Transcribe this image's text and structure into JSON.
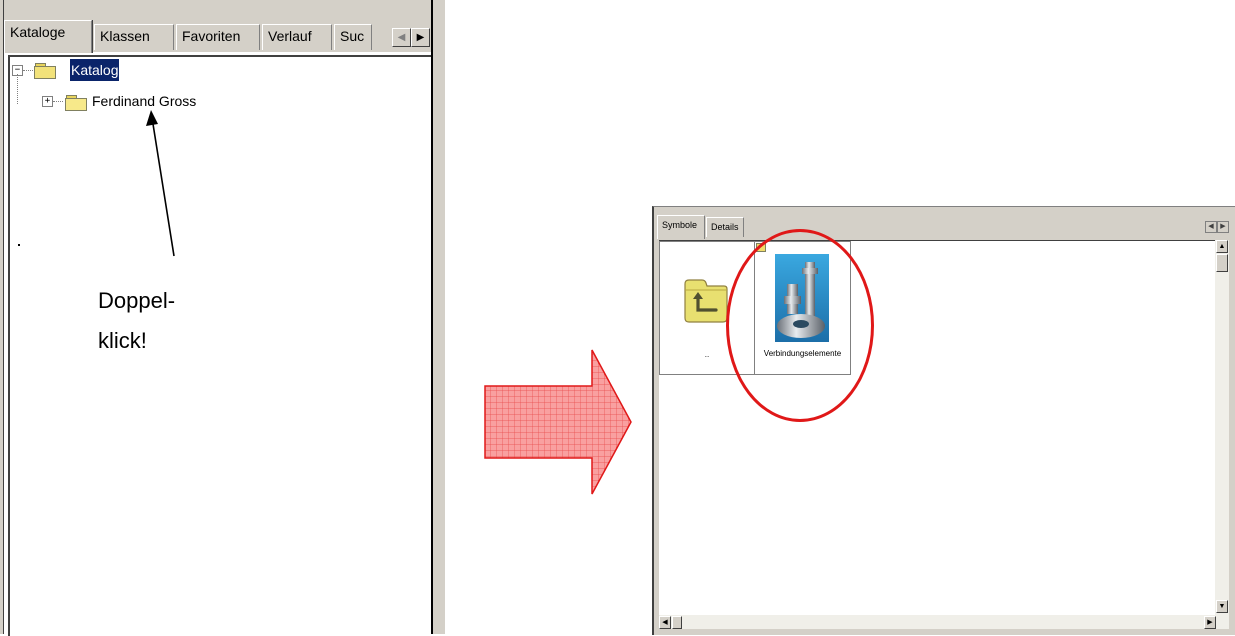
{
  "left_panel": {
    "tabs": [
      {
        "label": "Kataloge",
        "active": true
      },
      {
        "label": "Klassen",
        "active": false
      },
      {
        "label": "Favoriten",
        "active": false
      },
      {
        "label": "Verlauf",
        "active": false
      },
      {
        "label": "Suc",
        "active": false
      }
    ],
    "tree": {
      "root_label": "Katalog",
      "root_expanded": true,
      "root_selected": true,
      "children": [
        {
          "label": "Ferdinand Gross",
          "expanded": false
        }
      ]
    },
    "annotation": [
      "Doppel-",
      "klick!"
    ]
  },
  "right_window": {
    "tabs": [
      {
        "label": "Symbole",
        "active": true
      },
      {
        "label": "Details",
        "active": false
      }
    ],
    "items": [
      {
        "label": "..",
        "icon": "folder-up-icon"
      },
      {
        "label": "Verbindungselemente",
        "icon": "catalog-thumbnail-icon"
      }
    ]
  },
  "colors": {
    "selection": "#0a246a",
    "arrow_fill": "#f88a8a",
    "arrow_stroke": "#e01818",
    "highlight_ring": "#e01818"
  }
}
